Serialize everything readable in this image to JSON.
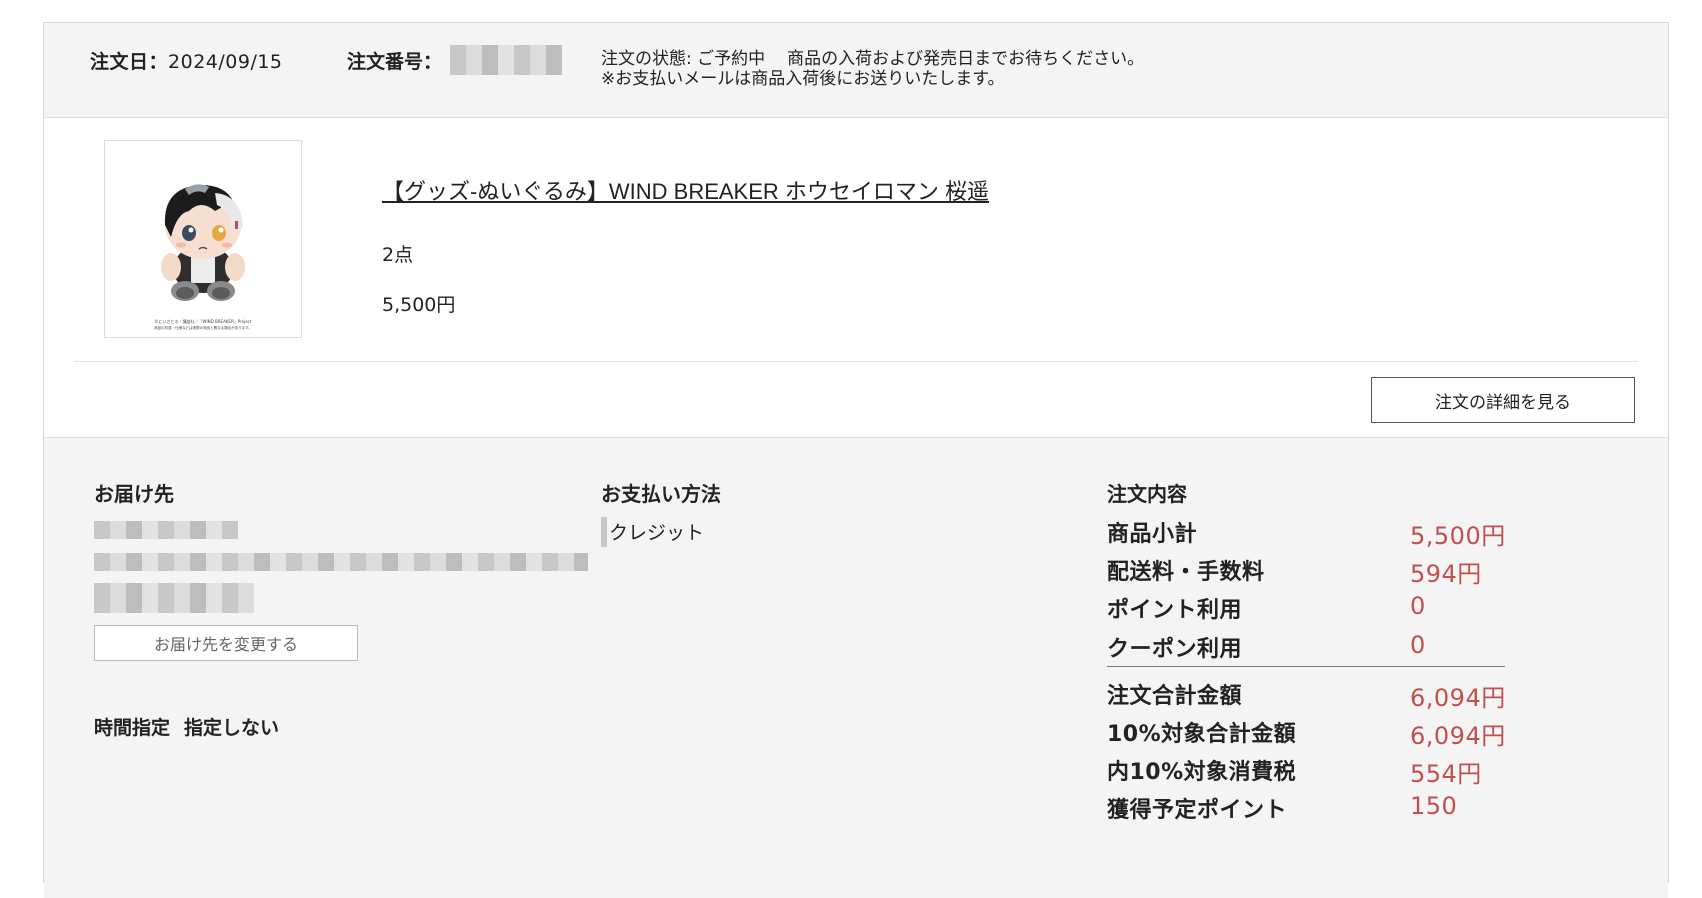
{
  "header": {
    "order_date_label": "注文日：",
    "order_date": "2024/09/15",
    "order_number_label": "注文番号：",
    "status_label": "注文の状態:",
    "status_value": "ご予約中",
    "status_message": "商品の入荷および発売日までお待ちください。",
    "status_note": "※お支払いメールは商品入荷後にお送りいたします。"
  },
  "item": {
    "title": "【グッズ-ぬいぐるみ】WIND BREAKER ホウセイロマン 桜遥",
    "quantity": "2点",
    "price": "5,500円",
    "thumb_caption_line1": "©にいさとる・講談社／「WIND BREAKER」Project",
    "thumb_caption_line2": "商品の質感・仕様などは実際の商品と異なる場合があります。"
  },
  "detail_button": "注文の詳細を見る",
  "delivery": {
    "title": "お届け先",
    "change_button": "お届け先を変更する",
    "time_label": "時間指定",
    "time_value": "指定しない"
  },
  "payment": {
    "title": "お支払い方法",
    "method": "クレジット"
  },
  "summary": {
    "title": "注文内容",
    "rows": [
      {
        "label": "商品小計",
        "value": "5,500円"
      },
      {
        "label": "配送料・手数料",
        "value": "594円"
      },
      {
        "label": "ポイント利用",
        "value": "0"
      },
      {
        "label": "クーポン利用",
        "value": "0"
      }
    ],
    "totals": [
      {
        "label": "注文合計金額",
        "value": "6,094円"
      },
      {
        "label": "10%対象合計金額",
        "value": "6,094円"
      },
      {
        "label": "内10%対象消費税",
        "value": "554円"
      },
      {
        "label": "獲得予定ポイント",
        "value": "150"
      }
    ]
  },
  "colors": {
    "accent_red": "#c0504d",
    "panel_bg": "#f4f4f4"
  }
}
